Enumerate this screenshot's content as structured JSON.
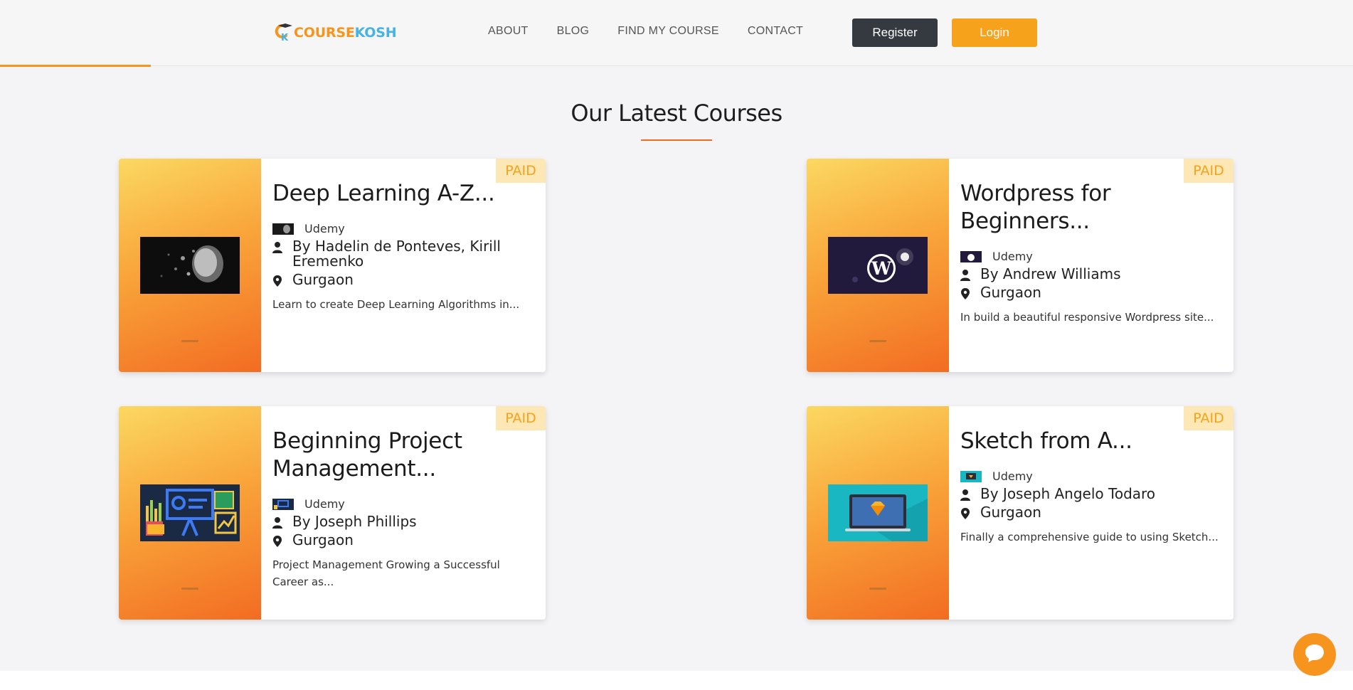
{
  "header": {
    "logo": {
      "prefix": "C",
      "k": "K",
      "name_main": "COURSE",
      "name_accent": "KOSH"
    },
    "nav": [
      "ABOUT",
      "BLOG",
      "FIND MY COURSE",
      "CONTACT"
    ],
    "register_label": "Register",
    "login_label": "Login"
  },
  "section": {
    "title": "Our Latest Courses"
  },
  "courses": [
    {
      "badge": "PAID",
      "title": "Deep Learning A-Z...",
      "provider": "Udemy",
      "author": "By Hadelin de Ponteves, Kirill Eremenko",
      "location": "Gurgaon",
      "description": "Learn to create Deep Learning Algorithms in...",
      "thumb": "ai-head-image"
    },
    {
      "badge": "PAID",
      "title": "Wordpress for Beginners...",
      "provider": "Udemy",
      "author": "By Andrew Williams",
      "location": "Gurgaon",
      "description": "In build a beautiful responsive Wordpress site...",
      "thumb": "wordpress-logo-image"
    },
    {
      "badge": "PAID",
      "title": "Beginning Project Management...",
      "provider": "Udemy",
      "author": "By Joseph Phillips",
      "location": "Gurgaon",
      "description": "Project Management Growing a Successful Career as...",
      "thumb": "presentation-board-image"
    },
    {
      "badge": "PAID",
      "title": "Sketch from A...",
      "provider": "Udemy",
      "author": "By Joseph Angelo Todaro",
      "location": "Gurgaon",
      "description": "Finally a comprehensive guide to using Sketch...",
      "thumb": "sketch-laptop-image"
    }
  ],
  "colors": {
    "accent_orange": "#f7941d",
    "register_bg": "#343a40",
    "login_bg": "#f7a21b",
    "badge_bg": "#fde7b4",
    "badge_text": "#f7a21b",
    "logo_blue": "#46b3e6"
  },
  "icons": {
    "author": "user-icon",
    "location": "map-pin-icon",
    "chat": "chat-bubble-icon"
  }
}
